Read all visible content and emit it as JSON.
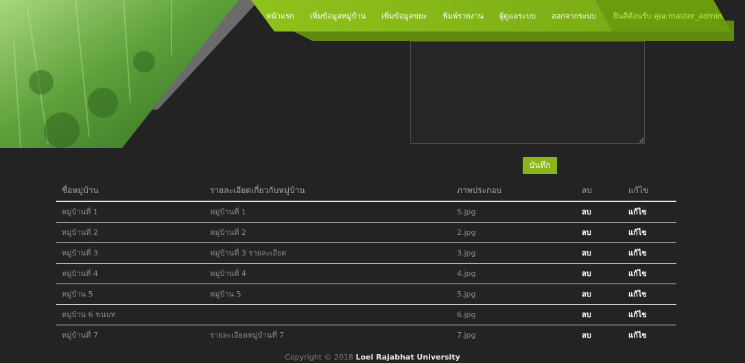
{
  "nav": {
    "items": [
      "หน้าแรก",
      "เพิ่มข้อมูลหมู่บ้าน",
      "เพิ่มข้อมูลขยะ",
      "พิมพ์รายงาน",
      "ผู้ดูแลระบบ",
      "ออกจากระบบ"
    ],
    "welcome": "ยินดีต้อนรับ คุณ:master_admin"
  },
  "form": {
    "notes_value": "",
    "save_label": "บันทึก"
  },
  "table": {
    "headers": [
      "ชื่อหมู่บ้าน",
      "รายละเอียดเกี่ยวกับหมู่บ้าน",
      "ภาพประกอบ",
      "ลบ",
      "แก้ไข"
    ],
    "rows": [
      {
        "name": "หมู่บ้านที่ 1",
        "detail": "หมู่บ้านที่ 1",
        "image": "5.jpg",
        "delete": "ลบ",
        "edit": "แก้ไข"
      },
      {
        "name": "หมู่บ้านที่ 2",
        "detail": "หมู่บ้านที่ 2",
        "image": "2.jpg",
        "delete": "ลบ",
        "edit": "แก้ไข"
      },
      {
        "name": "หมู่บ้านที่ 3",
        "detail": "หมู่บ้านที่ 3 รายละเอียด",
        "image": "3.jpg",
        "delete": "ลบ",
        "edit": "แก้ไข"
      },
      {
        "name": "หมู่บ้านที่ 4",
        "detail": "หมู่บ้านที่ 4",
        "image": "4.jpg",
        "delete": "ลบ",
        "edit": "แก้ไข"
      },
      {
        "name": "หมู่บ้าน 5",
        "detail": "หมู่บ้าน 5",
        "image": "5.jpg",
        "delete": "ลบ",
        "edit": "แก้ไข"
      },
      {
        "name": "หมู่บ้าน 6 ขนบท",
        "detail": "",
        "image": "6.jpg",
        "delete": "ลบ",
        "edit": "แก้ไข"
      },
      {
        "name": "หมู่บ้านที่ 7",
        "detail": "รายละเอียดหมู่บ้านที่ 7",
        "image": "7.jpg",
        "delete": "ลบ",
        "edit": "แก้ไข"
      }
    ]
  },
  "footer": {
    "prefix": "Copyright © 2018",
    "org": "Loei Rajabhat University"
  },
  "colors": {
    "accent": "#8ab417",
    "welcome": "#b9f24a",
    "background": "#232323"
  }
}
